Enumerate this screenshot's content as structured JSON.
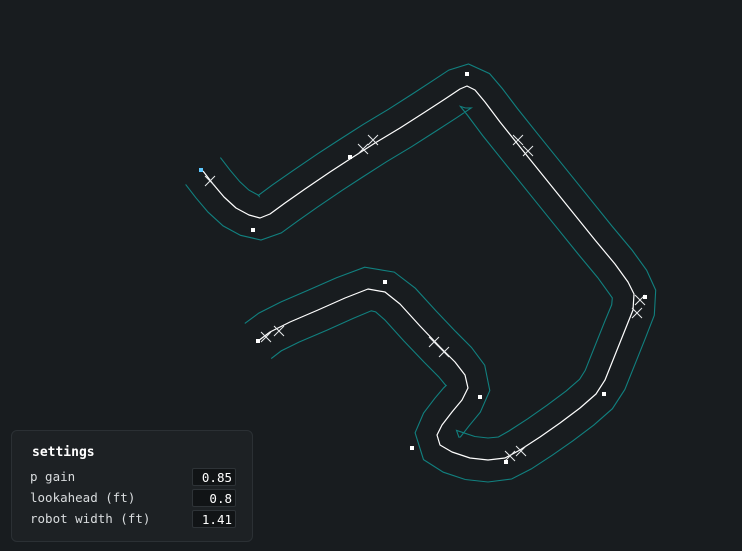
{
  "colors": {
    "background": "#181c1f",
    "path": "#ffffff",
    "boundary": "#11807f",
    "start_marker": "#5ec8ff",
    "panel": "#1d2124"
  },
  "settings": {
    "title": "settings",
    "fields": [
      {
        "label": "p gain",
        "value": "0.85"
      },
      {
        "label": "lookahead (ft)",
        "value": "0.8"
      },
      {
        "label": "robot width (ft)",
        "value": "1.41"
      }
    ]
  }
}
